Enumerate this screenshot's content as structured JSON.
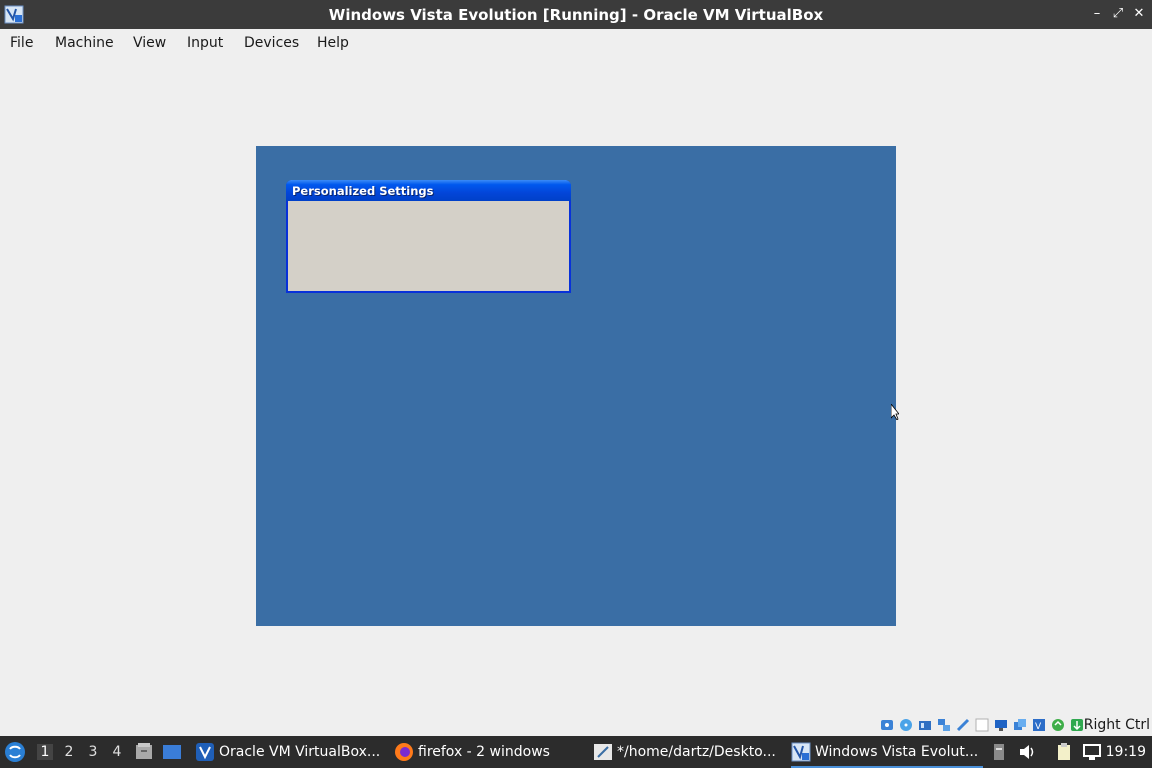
{
  "window": {
    "title": "Windows Vista Evolution [Running] - Oracle VM VirtualBox",
    "minimize_glyph": "–",
    "restore_glyph": "⤢",
    "close_glyph": "✕"
  },
  "menubar": {
    "items": [
      "File",
      "Machine",
      "View",
      "Input",
      "Devices",
      "Help"
    ]
  },
  "vm": {
    "desktop_color": "#3a6ea5",
    "dialog": {
      "title": "Personalized Settings"
    }
  },
  "statusbar": {
    "icons": [
      "hard-disk-icon",
      "optical-drive-icon",
      "audio-icon",
      "network-icon",
      "usb-icon",
      "shared-folders-icon",
      "display-icon",
      "video-capture-icon",
      "virtualization-icon",
      "mouse-integration-icon",
      "keyboard-icon"
    ],
    "host_key": "Right Ctrl"
  },
  "taskbar": {
    "workspaces": [
      "1",
      "2",
      "3",
      "4"
    ],
    "active_workspace": "1",
    "tasks": [
      {
        "label": "Oracle VM VirtualBox...",
        "icon": "virtualbox-icon"
      },
      {
        "label": "firefox - 2 windows",
        "icon": "firefox-icon"
      },
      {
        "label": "*/home/dartz/Deskto...",
        "icon": "text-editor-icon"
      },
      {
        "label": "Windows Vista Evolut...",
        "icon": "virtualbox-vm-icon",
        "active": true
      }
    ],
    "clock": "19:19"
  }
}
